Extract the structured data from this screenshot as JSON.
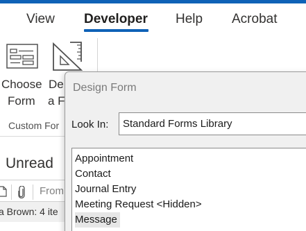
{
  "ribbon": {
    "tabs": [
      {
        "label": "View"
      },
      {
        "label": "Developer",
        "active": true
      },
      {
        "label": "Help"
      },
      {
        "label": "Acrobat"
      }
    ],
    "buttons": [
      {
        "line1": "Choose",
        "line2": "Form",
        "icon": "choose-form-icon"
      },
      {
        "line1": "De",
        "line2": "a F",
        "icon": "design-form-icon"
      }
    ],
    "group_label": "Custom For",
    "accent_color": "#0f62b7"
  },
  "mail": {
    "unread_label": "Unread",
    "from_label": "From",
    "status_text": "a Brown: 4 ite",
    "toolbar_icons": [
      "doc-icon",
      "attachment-icon"
    ]
  },
  "dialog": {
    "title": "Design Form",
    "look_in_label": "Look In:",
    "look_in_value": "Standard Forms Library",
    "forms": [
      {
        "name": "Appointment"
      },
      {
        "name": "Contact"
      },
      {
        "name": "Journal Entry"
      },
      {
        "name": "Meeting Request <Hidden>"
      },
      {
        "name": "Message",
        "selected": true
      }
    ]
  }
}
